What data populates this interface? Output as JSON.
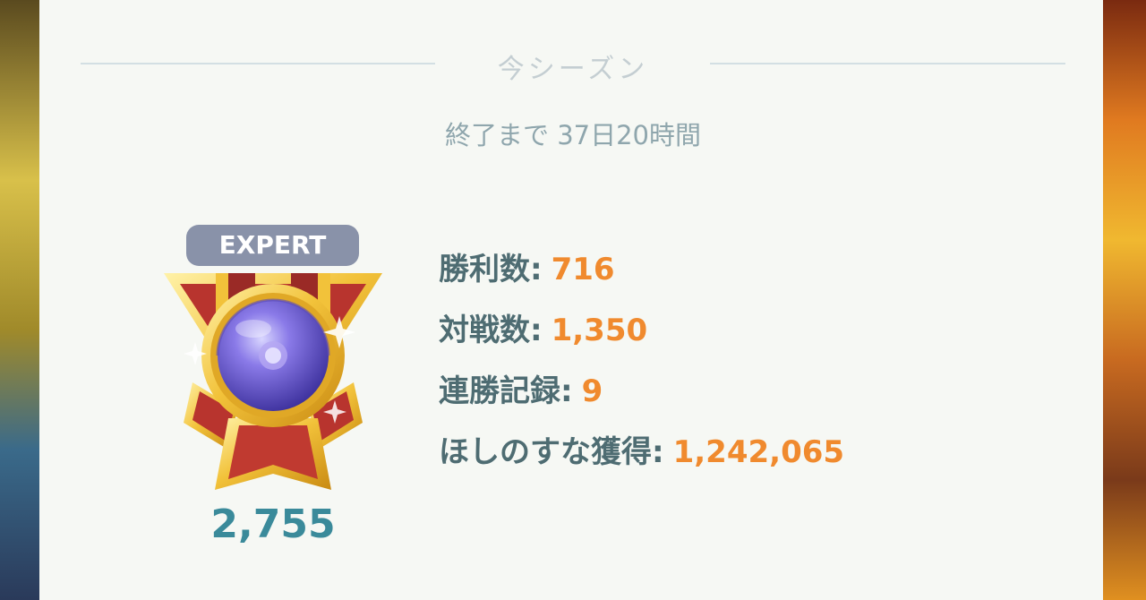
{
  "season": {
    "title": "今シーズン",
    "countdown": "終了まで 37日20時間"
  },
  "rank": {
    "label": "EXPERT",
    "rating": "2,755"
  },
  "stats": [
    {
      "label": "勝利数:",
      "value": "716"
    },
    {
      "label": "対戦数:",
      "value": "1,350"
    },
    {
      "label": "連勝記録:",
      "value": "9"
    },
    {
      "label": "ほしのすな獲得:",
      "value": "1,242,065"
    }
  ],
  "colors": {
    "label": "#4e6c72",
    "value": "#f08a2e",
    "rating": "#3a8a9a",
    "badge": "#8992a9",
    "card": "#f6f8f4"
  },
  "icons": {
    "medal": "expert-medal-icon"
  }
}
